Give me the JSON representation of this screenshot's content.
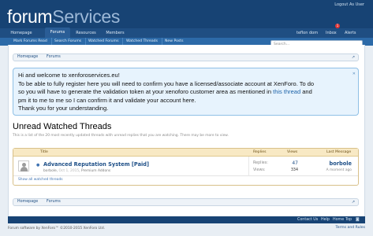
{
  "header": {
    "logo_prefix": "forum",
    "logo_suffix": "Services",
    "logout": "Logout As User"
  },
  "nav": {
    "tabs": [
      "Homepage",
      "Forums",
      "Resources",
      "Members"
    ],
    "account": {
      "user": "teflon dom",
      "inbox": "Inbox",
      "inbox_count": "1",
      "alerts": "Alerts"
    }
  },
  "subnav": {
    "items": [
      "Mark Forums Read",
      "Search Forums",
      "Watched Forums",
      "Watched Threads",
      "New Posts"
    ]
  },
  "search": {
    "placeholder": "Search..."
  },
  "breadcrumb": {
    "items": [
      "Homepage",
      "Forums"
    ]
  },
  "notice": {
    "line1": "Hi and welcome to xenforoservices.eu!",
    "line2": "To be able to fully register here you will need to confirm you have a licensed/associate account at XenForo. To do",
    "line3a": "so you will have to generate the validation token at your xenoforo customer area as mentioned in ",
    "line3_link": "this thread",
    "line3b": " and",
    "line4": "pm it to me to me so I can confirm it and validate your account here.",
    "line5": "Thank you for your understanding."
  },
  "page": {
    "title": "Unread Watched Threads",
    "description": "This is a list of the 20 most recently updated threads with unread replies that you are watching. There may be more to view."
  },
  "table": {
    "headers": {
      "title": "Title",
      "replies": "Replies",
      "views": "Views",
      "last": "Last Message"
    },
    "rows": [
      {
        "title": "Advanced Reputation System [Paid]",
        "author": "borbole",
        "date": "Oct 1, 2015",
        "prefix": "Premium Addons",
        "replies_label": "Replies:",
        "replies": "47",
        "views_label": "Views:",
        "views": "334",
        "last_user": "borbole",
        "last_date": "A moment ago"
      }
    ],
    "show_all": "Show all watched threads"
  },
  "footer": {
    "links": [
      "Contact Us",
      "Help",
      "Home",
      "Top"
    ],
    "copyright": "Forum software by XenForo™ ©2010-2015 XenForo Ltd.",
    "terms": "Terms and Rules"
  },
  "colors": {
    "header": "#174374",
    "nav": "#2c6aa8",
    "notice_bg": "#e7f3fd",
    "table_header": "#f8e9c4"
  }
}
